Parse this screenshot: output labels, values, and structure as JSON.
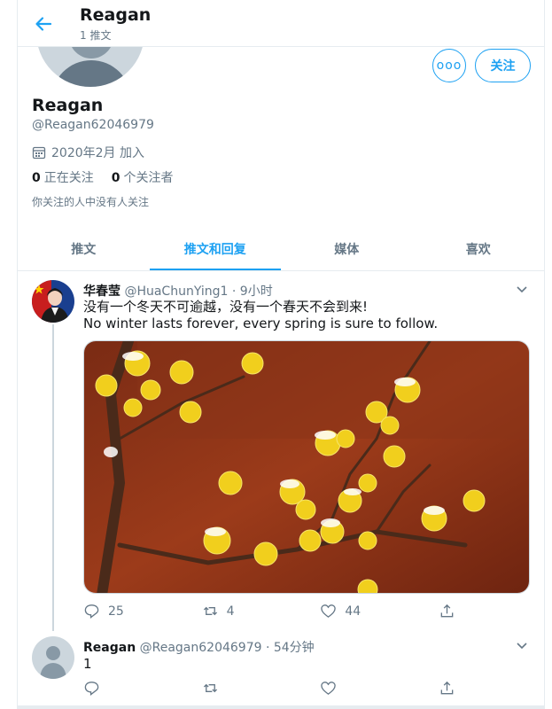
{
  "header": {
    "title": "Reagan",
    "tweet_count": "1 推文"
  },
  "profile": {
    "name": "Reagan",
    "handle": "@Reagan62046979",
    "joined": "2020年2月 加入",
    "following_count": "0",
    "following_label": "正在关注",
    "followers_count": "0",
    "followers_label": "个关注者",
    "no_follow_note": "你关注的人中没有人关注",
    "follow_label": "关注",
    "more_label": "ooo"
  },
  "tabs": [
    {
      "label": "推文",
      "active": false
    },
    {
      "label": "推文和回复",
      "active": true
    },
    {
      "label": "媒体",
      "active": false
    },
    {
      "label": "喜欢",
      "active": false
    }
  ],
  "tweets": [
    {
      "author": "华春莹",
      "handle": "@HuaChunYing1",
      "time": "· 9小时",
      "text_line1": "没有一个冬天不可逾越，没有一个春天不会到来!",
      "text_line2": "No winter lasts forever, every spring is sure to follow.",
      "replies": "25",
      "retweets": "4",
      "likes": "44"
    },
    {
      "author": "Reagan",
      "handle": "@Reagan62046979",
      "time": "· 54分钟",
      "text": "1",
      "replies": "",
      "retweets": "",
      "likes": ""
    }
  ],
  "colors": {
    "accent": "#1da1f2",
    "secondary_text": "#657786",
    "border": "#e6ecf0"
  },
  "icons": [
    "back-arrow-icon",
    "calendar-icon",
    "chevron-down-icon",
    "reply-icon",
    "retweet-icon",
    "like-icon",
    "share-icon"
  ]
}
